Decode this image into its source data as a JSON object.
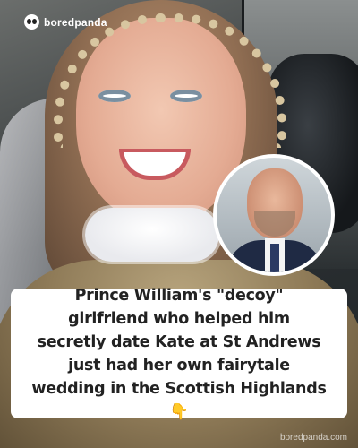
{
  "brand": {
    "name": "boredpanda",
    "watermark": "boredpanda.com"
  },
  "headline": {
    "lines": [
      "Prince William's \"decoy\"",
      "girlfriend who helped him",
      "secretly date Kate at St Andrews",
      "just had her own fairytale",
      "wedding in the Scottish Highlands"
    ],
    "emoji": "👇"
  },
  "icons": {
    "logo": "panda-logo-icon",
    "pointer": "pointing-down-hand-icon"
  },
  "colors": {
    "headline_bg": "#ffffff",
    "headline_text": "#222222",
    "logo_text": "#ffffff"
  }
}
